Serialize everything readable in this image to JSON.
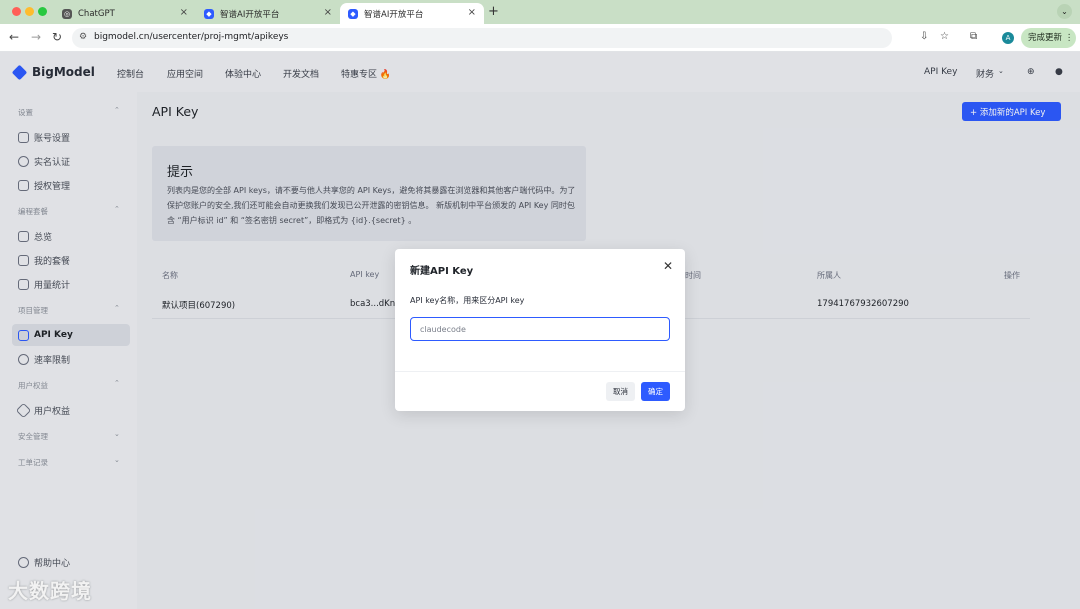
{
  "browser": {
    "tabs": [
      {
        "title": "ChatGPT",
        "icon": "chatgpt-icon"
      },
      {
        "title": "智谱AI开放平台",
        "icon": "zhipu-icon"
      },
      {
        "title": "智谱AI开放平台",
        "icon": "zhipu-icon"
      }
    ],
    "url": "bigmodel.cn/usercenter/proj-mgmt/apikeys",
    "avatar_letter": "A",
    "update_label": "完成更新 ⋮"
  },
  "header": {
    "brand": "BigModel",
    "nav": [
      "控制台",
      "应用空间",
      "体验中心",
      "开发文档",
      "特惠专区 🔥"
    ],
    "right": {
      "api_key": "API Key",
      "finance": "财务"
    }
  },
  "sidebar": {
    "sections": [
      {
        "label": "设置",
        "items": [
          "账号设置",
          "实名认证",
          "授权管理"
        ]
      },
      {
        "label": "编程套餐",
        "items": [
          "总览",
          "我的套餐",
          "用量统计"
        ]
      },
      {
        "label": "项目管理",
        "items": [
          "API Key",
          "速率限制"
        ]
      },
      {
        "label": "用户权益",
        "items": [
          "用户权益"
        ]
      },
      {
        "label": "安全管理",
        "items": []
      },
      {
        "label": "工单记录",
        "items": []
      }
    ],
    "active_item": "API Key",
    "help": "帮助中心"
  },
  "main": {
    "title": "API Key",
    "add_button": "+ 添加新的API Key",
    "tip": {
      "title": "提示",
      "text": "列表内是您的全部 API keys，请不要与他人共享您的 API Keys，避免将其暴露在浏览器和其他客户端代码中。为了保护您账户的安全,我们还可能会自动更换我们发现已公开泄露的密钥信息。 新版机制中平台颁发的 API Key 同时包含 “用户标识 id” 和 “签名密钥 secret”，即格式为 {id}.{secret} 。"
    },
    "table": {
      "headers": [
        "名称",
        "API key",
        "时间",
        "所属人",
        "操作"
      ],
      "rows": [
        {
          "name": "默认项目(607290)",
          "key": "bca3...dKn3",
          "owner": "17941767932607290"
        }
      ]
    }
  },
  "modal": {
    "title": "新建API Key",
    "label": "API key名称，用来区分API key",
    "input_value": "claudecode",
    "cancel": "取消",
    "confirm": "确定"
  },
  "watermark": "大数跨境",
  "colors": {
    "primary": "#2e5bff",
    "tabbar": "#c9dfc6"
  }
}
